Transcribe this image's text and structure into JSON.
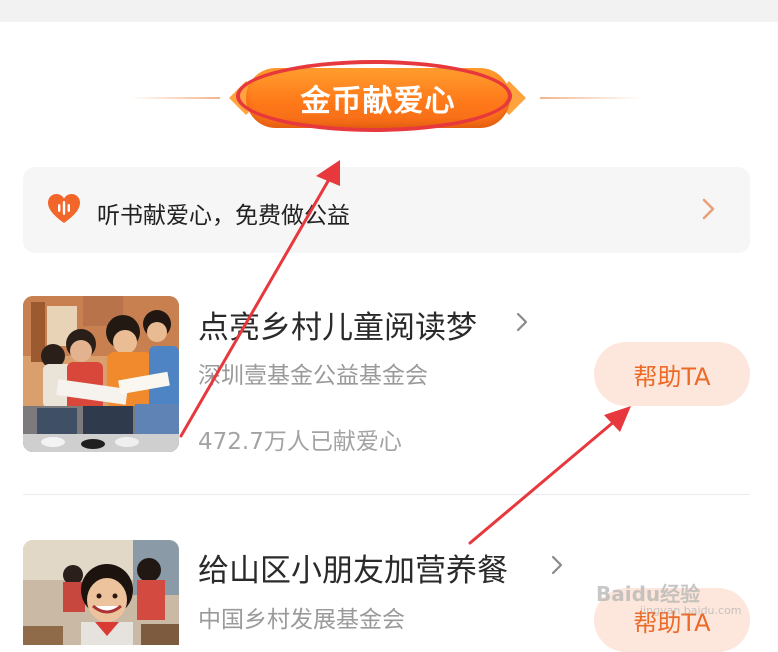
{
  "header": {
    "title": "金币献爱心"
  },
  "banner": {
    "text": "听书献爱心，免费做公益"
  },
  "items": [
    {
      "title": "点亮乡村儿童阅读梦",
      "org": "深圳壹基金公益基金会",
      "count": "472.7万人已献爱心",
      "button": "帮助TA"
    },
    {
      "title": "给山区小朋友加营养餐",
      "org": "中国乡村发展基金会",
      "button": "帮助TA"
    }
  ],
  "watermark": {
    "text": "Baidu经验",
    "sub": "jingyan.baidu.com"
  },
  "colors": {
    "accent": "#ff7a1a",
    "annotation": "#e6383d",
    "button_bg": "#fde7dc",
    "button_text": "#ec6a27"
  }
}
